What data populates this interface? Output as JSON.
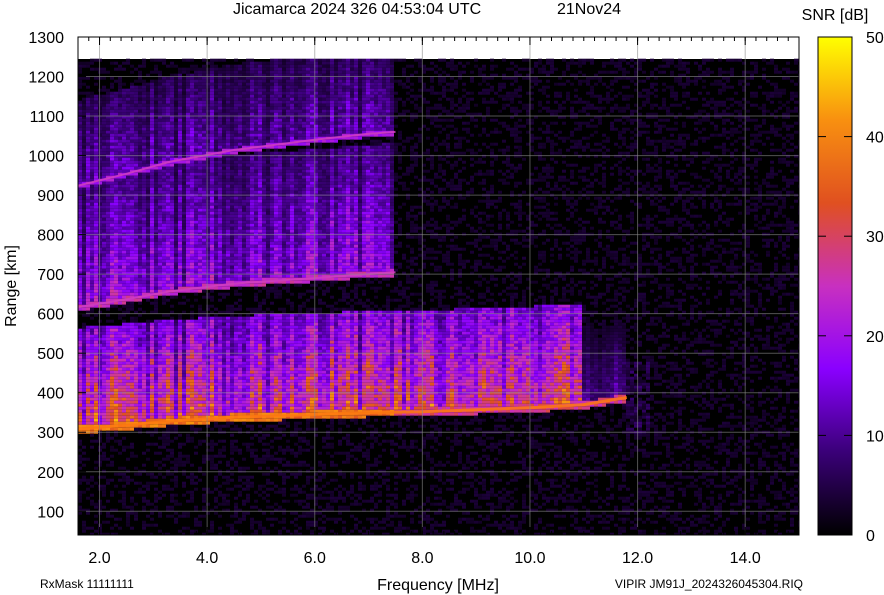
{
  "chart_data": {
    "type": "heatmap",
    "title": "Jicamarca 2024 326 04:53:04 UTC",
    "date": "21Nov24",
    "xlabel": "Frequency [MHz]",
    "ylabel": "Range [km]",
    "xlim": [
      1.6,
      15.0
    ],
    "ylim": [
      40,
      1300
    ],
    "xticks": [
      "2.0",
      "4.0",
      "6.0",
      "8.0",
      "10.0",
      "12.0",
      "14.0"
    ],
    "xtick_values": [
      2,
      4,
      6,
      8,
      10,
      12,
      14
    ],
    "yticks": [
      "100",
      "200",
      "300",
      "400",
      "500",
      "600",
      "700",
      "800",
      "900",
      "1000",
      "1100",
      "1200",
      "1300"
    ],
    "ytick_values": [
      100,
      200,
      300,
      400,
      500,
      600,
      700,
      800,
      900,
      1000,
      1100,
      1200,
      1300
    ],
    "colorbar": {
      "label": "SNR [dB]",
      "range": [
        0,
        50
      ],
      "ticks": [
        "0",
        "10",
        "20",
        "30",
        "40",
        "50"
      ],
      "tick_values": [
        0,
        10,
        20,
        30,
        40,
        50
      ],
      "colors": [
        "#000000",
        "#3a0078",
        "#8a00ff",
        "#c830c0",
        "#e05020",
        "#f89010",
        "#ffff00"
      ]
    },
    "grid": true,
    "echo_traces": [
      {
        "x": [
          1.6,
          2.5,
          3.3,
          4.5,
          6.0,
          7.0,
          8.0,
          9.0,
          10.0,
          11.0,
          11.8
        ],
        "y": [
          308,
          318,
          328,
          338,
          345,
          350,
          352,
          357,
          362,
          370,
          388
        ]
      },
      {
        "x": [
          1.6,
          2.5,
          3.3,
          4.5,
          6.0,
          7.0,
          7.5
        ],
        "y": [
          616,
          636,
          656,
          676,
          690,
          700,
          705
        ]
      },
      {
        "x": [
          1.6,
          2.5,
          3.3,
          4.5,
          6.0,
          7.0,
          7.5
        ],
        "y": [
          924,
          954,
          984,
          1014,
          1040,
          1055,
          1060
        ]
      }
    ],
    "footer_left": "RxMask 11111111",
    "footer_right": "VIPIR  JM91J_2024326045304.RIQ"
  }
}
